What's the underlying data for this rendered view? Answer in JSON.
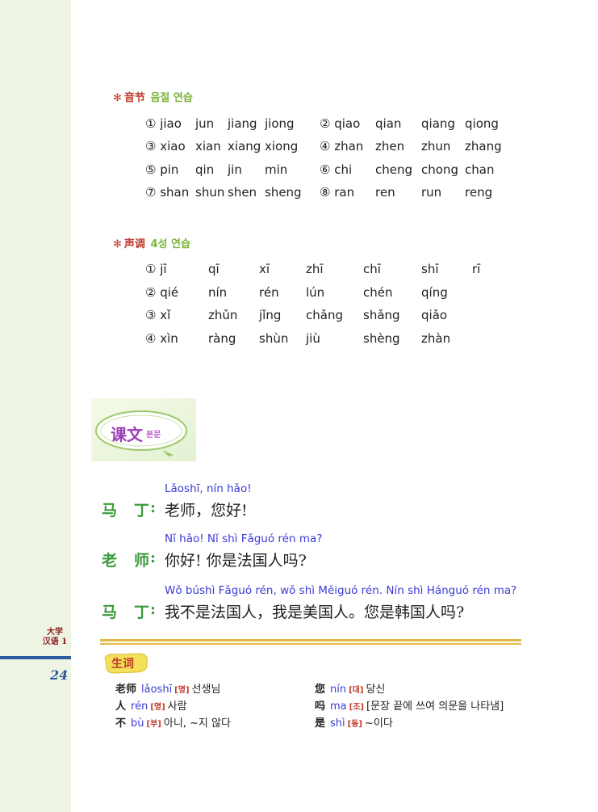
{
  "margin": {
    "book_title": "大学\n汉语 1",
    "page_number": "24"
  },
  "syllables": {
    "title_zh": "音节",
    "title_ko": "음절 연습",
    "rows": [
      [
        "① jiao",
        "jun",
        "jiang",
        "jiong",
        "② qiao",
        "qian",
        "qiang",
        "qiong"
      ],
      [
        "③ xiao",
        "xian",
        "xiang",
        "xiong",
        "④ zhan",
        "zhen",
        "zhun",
        "zhang"
      ],
      [
        "⑤ pin",
        "qin",
        "jin",
        "min",
        "⑥ chi",
        "cheng",
        "chong",
        "chan"
      ],
      [
        "⑦ shan",
        "shun",
        "shen",
        "sheng",
        "⑧ ran",
        "ren",
        "run",
        "reng"
      ]
    ]
  },
  "tones": {
    "title_zh": "声调",
    "title_ko": "4성 연습",
    "rows": [
      [
        "① jī",
        "qī",
        "xī",
        "zhī",
        "chī",
        "shī",
        "rī"
      ],
      [
        "② qié",
        "nín",
        "rén",
        "lún",
        "chén",
        "qíng",
        ""
      ],
      [
        "③ xǐ",
        "zhǔn",
        "jǐng",
        "chǎng",
        "shǎng",
        "qiǎo",
        ""
      ],
      [
        "④ xìn",
        "ràng",
        "shùn",
        "jiù",
        "shèng",
        "zhàn",
        ""
      ]
    ]
  },
  "lesson": {
    "badge_zh": "课文",
    "badge_ko": "본문",
    "lines": [
      {
        "speaker": [
          "马",
          "丁"
        ],
        "pinyin": "Lǎoshī, nín hǎo!",
        "text": "老师，您好!"
      },
      {
        "speaker": [
          "老",
          "师"
        ],
        "pinyin": "Nǐ hǎo!  Nǐ shì Fǎguó rén ma?",
        "text": "你好! 你是法国人吗?"
      },
      {
        "speaker": [
          "马",
          "丁"
        ],
        "pinyin": "Wǒ búshì Fǎguó rén, wǒ shì Měiguó rén. Nín shì Hánguó rén ma?",
        "text": "我不是法国人，我是美国人。您是韩国人吗?"
      }
    ]
  },
  "vocab": {
    "badge": "生词",
    "left": [
      {
        "hz": "老师",
        "py": "lǎoshī",
        "pos": "[명]",
        "ko": "선생님"
      },
      {
        "hz": "人",
        "py": "rén",
        "pos": "[명]",
        "ko": "사람"
      },
      {
        "hz": "不",
        "py": "bù",
        "pos": "[부]",
        "ko": "아니, ~지 않다"
      }
    ],
    "right": [
      {
        "hz": "您",
        "py": "nín",
        "pos": "[대]",
        "ko": "당신"
      },
      {
        "hz": "吗",
        "py": "ma",
        "pos": "[조]",
        "ko": "[문장 끝에 쓰여 의문을 나타냄]"
      },
      {
        "hz": "是",
        "py": "shì",
        "pos": "[동]",
        "ko": "~이다"
      }
    ]
  }
}
